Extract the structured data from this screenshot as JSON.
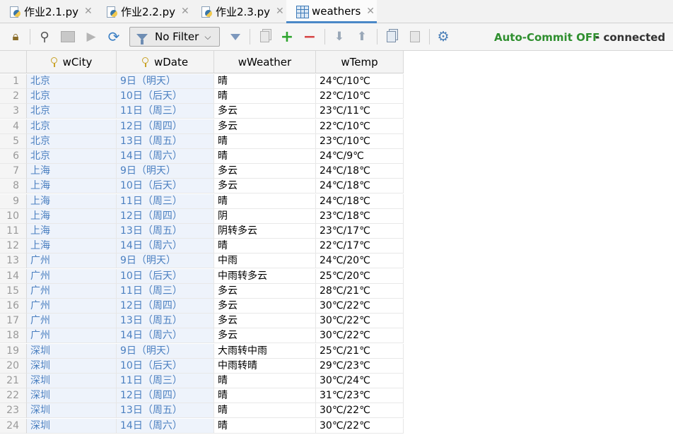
{
  "tabs": [
    {
      "label": "作业2.1.py",
      "icon": "python-file-icon",
      "active": false
    },
    {
      "label": "作业2.2.py",
      "icon": "python-file-icon",
      "active": false
    },
    {
      "label": "作业2.3.py",
      "icon": "python-file-icon",
      "active": false
    },
    {
      "label": "weathers",
      "icon": "table-icon",
      "active": true
    }
  ],
  "toolbar": {
    "filter_label": "No Filter",
    "commit_status": "Auto-Commit OFF",
    "connection_status": "- connected",
    "icons": [
      "lock-icon",
      "search-icon",
      "view-icon",
      "run-icon",
      "refresh-icon",
      "clear-filter-icon",
      "copy-icon",
      "add-icon",
      "remove-icon",
      "move-down-icon",
      "move-up-icon",
      "clone-icon",
      "paste-icon",
      "settings-icon"
    ]
  },
  "colors": {
    "accent": "#4a88c7",
    "commit": "#2f8f2f",
    "key_value": "#4a7fc0"
  },
  "table": {
    "columns": [
      "wCity",
      "wDate",
      "wWeather",
      "wTemp"
    ],
    "rows": [
      [
        "1",
        "北京",
        "9日（明天）",
        "晴",
        "24℃/10℃"
      ],
      [
        "2",
        "北京",
        "10日（后天）",
        "晴",
        "22℃/10℃"
      ],
      [
        "3",
        "北京",
        "11日（周三）",
        "多云",
        "23℃/11℃"
      ],
      [
        "4",
        "北京",
        "12日（周四）",
        "多云",
        "22℃/10℃"
      ],
      [
        "5",
        "北京",
        "13日（周五）",
        "晴",
        "23℃/10℃"
      ],
      [
        "6",
        "北京",
        "14日（周六）",
        "晴",
        "24℃/9℃"
      ],
      [
        "7",
        "上海",
        "9日（明天）",
        "多云",
        "24℃/18℃"
      ],
      [
        "8",
        "上海",
        "10日（后天）",
        "多云",
        "24℃/18℃"
      ],
      [
        "9",
        "上海",
        "11日（周三）",
        "晴",
        "24℃/18℃"
      ],
      [
        "10",
        "上海",
        "12日（周四）",
        "阴",
        "23℃/18℃"
      ],
      [
        "11",
        "上海",
        "13日（周五）",
        "阴转多云",
        "23℃/17℃"
      ],
      [
        "12",
        "上海",
        "14日（周六）",
        "晴",
        "22℃/17℃"
      ],
      [
        "13",
        "广州",
        "9日（明天）",
        "中雨",
        "24℃/20℃"
      ],
      [
        "14",
        "广州",
        "10日（后天）",
        "中雨转多云",
        "25℃/20℃"
      ],
      [
        "15",
        "广州",
        "11日（周三）",
        "多云",
        "28℃/21℃"
      ],
      [
        "16",
        "广州",
        "12日（周四）",
        "多云",
        "30℃/22℃"
      ],
      [
        "17",
        "广州",
        "13日（周五）",
        "多云",
        "30℃/22℃"
      ],
      [
        "18",
        "广州",
        "14日（周六）",
        "多云",
        "30℃/22℃"
      ],
      [
        "19",
        "深圳",
        "9日（明天）",
        "大雨转中雨",
        "25℃/21℃"
      ],
      [
        "20",
        "深圳",
        "10日（后天）",
        "中雨转晴",
        "29℃/23℃"
      ],
      [
        "21",
        "深圳",
        "11日（周三）",
        "晴",
        "30℃/24℃"
      ],
      [
        "22",
        "深圳",
        "12日（周四）",
        "晴",
        "31℃/23℃"
      ],
      [
        "23",
        "深圳",
        "13日（周五）",
        "晴",
        "30℃/22℃"
      ],
      [
        "24",
        "深圳",
        "14日（周六）",
        "晴",
        "30℃/22℃"
      ]
    ]
  }
}
